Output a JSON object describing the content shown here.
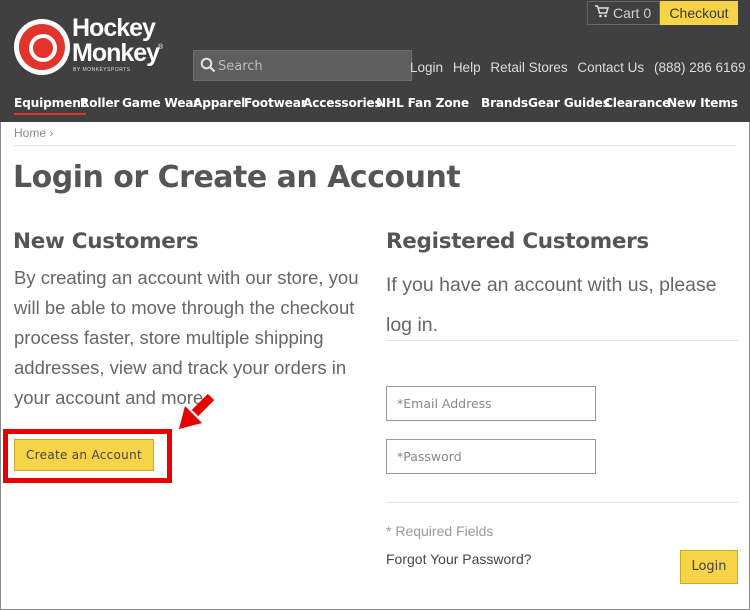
{
  "header": {
    "logo_line1": "Hockey",
    "logo_line2": "Monkey",
    "logo_sub": "BY MONKEYSPORTS",
    "logo_reg": "®",
    "cart_label": "Cart 0",
    "checkout_label": "Checkout",
    "search_placeholder": "Search",
    "util_links": [
      "Login",
      "Help",
      "Retail Stores",
      "Contact Us"
    ],
    "phone": "(888) 286 6169",
    "nav": [
      "Equipment",
      "Roller",
      "Game Wear",
      "Apparel",
      "Footwear",
      "Accessories",
      "NHL Fan Zone",
      "Brands",
      "Gear Guides",
      "Clearance",
      "New Items"
    ],
    "accent_color": "#e2342b",
    "button_color": "#f7d347"
  },
  "breadcrumb": {
    "home": "Home",
    "separator": "›"
  },
  "page_title": "Login or Create an Account",
  "new_customers": {
    "title": "New Customers",
    "description": "By creating an account with our store, you will be able to move through the checkout process faster, store multiple shipping addresses, view and track your orders in your account and more.",
    "button_label": "Create an Account"
  },
  "registered_customers": {
    "title": "Registered Customers",
    "description": "If you have an account with us, please log in.",
    "email_placeholder": "*Email Address",
    "password_placeholder": "*Password",
    "required_note": "* Required Fields",
    "forgot_label": "Forgot Your Password?",
    "login_label": "Login"
  },
  "annotation": {
    "highlight_color": "#e60000"
  }
}
